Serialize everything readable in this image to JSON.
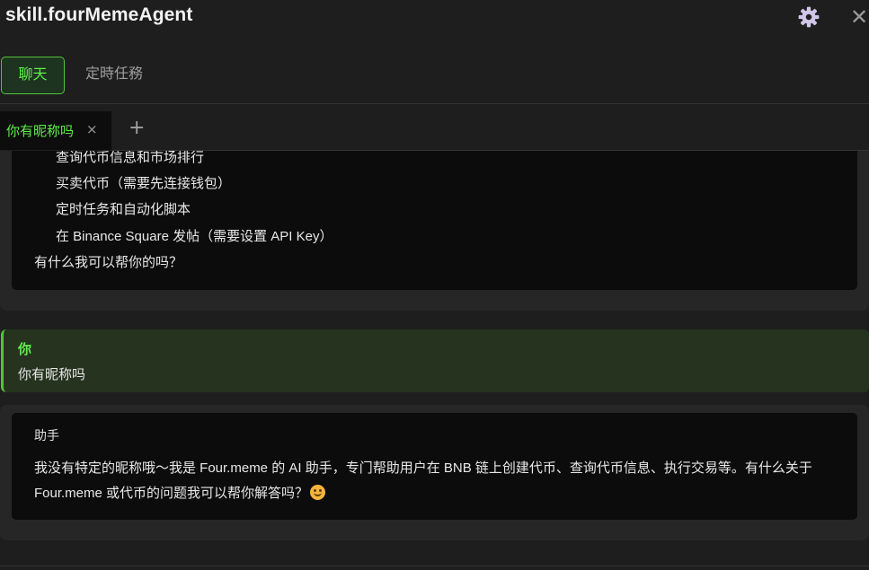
{
  "app": {
    "title": "skill.fourMemeAgent",
    "settings_icon": "gear-icon",
    "close_glyph": "✕"
  },
  "main_tabs": [
    {
      "label": "聊天",
      "active": true
    },
    {
      "label": "定時任務",
      "active": false
    }
  ],
  "chat_tabs": {
    "items": [
      {
        "label": "你有昵称吗",
        "close_glyph": "×",
        "active": true
      }
    ],
    "add_glyph": "+"
  },
  "messages": [
    {
      "role": "assistant",
      "lines": [
        "查询代币信息和市场排行",
        "买卖代币（需要先连接钱包）",
        "定时任务和自动化脚本",
        "在 Binance Square 发帖（需要设置 API Key）",
        "有什么我可以帮你的吗？"
      ]
    },
    {
      "role": "user",
      "author": "你",
      "text": "你有昵称吗"
    },
    {
      "role": "assistant",
      "author": "助手",
      "text": "我没有特定的昵称哦～我是 Four.meme 的 AI 助手，专门帮助用户在 BNB 链上创建代币、查询代币信息、执行交易等。有什么关于 Four.meme 或代币的问题我可以帮你解答吗？",
      "emoji": "smiling-face-icon"
    }
  ],
  "colors": {
    "accent": "#5ef04a",
    "background": "#1e1e1e",
    "bubble": "#0c0c0c",
    "user_bubble": "#26331f"
  }
}
